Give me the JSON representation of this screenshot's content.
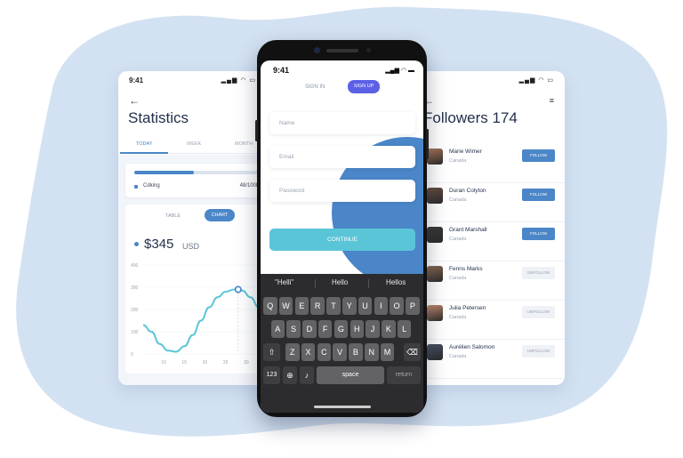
{
  "colors": {
    "accent": "#4a86c8",
    "signup": "#5b60e6",
    "continue": "#5bc5d8",
    "blob": "#d3e2f2"
  },
  "left_screen": {
    "time": "9:41",
    "title": "Statistics",
    "tabs": [
      "TODAY",
      "WEEK",
      "MONTH"
    ],
    "progress_label": "Cdking",
    "progress_value": "48/100km",
    "progress_fraction": 0.48,
    "segments": {
      "table": "TABLE",
      "chart": "CHART"
    },
    "amount": "$345",
    "currency": "USD"
  },
  "chart_data": {
    "type": "line",
    "x_ticks": [
      "10",
      "15",
      "20",
      "25",
      "30"
    ],
    "y_ticks": [
      "0",
      "100",
      "200",
      "300",
      "400"
    ],
    "ylim": [
      0,
      400
    ],
    "xlim": [
      5,
      33
    ],
    "series": [
      {
        "x": [
          5,
          7,
          9,
          11,
          13,
          15,
          17,
          19,
          21,
          23,
          25,
          27,
          29,
          31,
          33
        ],
        "y": [
          130,
          100,
          45,
          15,
          10,
          35,
          85,
          150,
          210,
          255,
          280,
          290,
          285,
          255,
          210
        ]
      }
    ],
    "highlight": {
      "x": 28,
      "y": 290
    }
  },
  "phone": {
    "time": "9:41",
    "signin": "SIGN IN",
    "signup": "SIGN UP",
    "fields": {
      "name": "Name",
      "email": "Email",
      "password": "Password"
    },
    "continue": "CONTINUE",
    "suggestions": [
      "\"Helli\"",
      "Hello",
      "Hellos"
    ],
    "rows": [
      [
        "Q",
        "W",
        "E",
        "R",
        "T",
        "Y",
        "U",
        "I",
        "O",
        "P"
      ],
      [
        "A",
        "S",
        "D",
        "F",
        "G",
        "H",
        "J",
        "K",
        "L"
      ],
      [
        "Z",
        "X",
        "C",
        "V",
        "B",
        "N",
        "M"
      ]
    ],
    "bottom": {
      "numbers": "123",
      "space": "space",
      "return": "return"
    }
  },
  "right_screen": {
    "time": "9:41",
    "title": "Followers 174",
    "followers": [
      {
        "name": "Marie Wimer",
        "country": "Canada",
        "action": "FOLLOW"
      },
      {
        "name": "Duran Colyton",
        "country": "Canada",
        "action": "FOLLOW"
      },
      {
        "name": "Grant Marshall",
        "country": "Canada",
        "action": "FOLLOW"
      },
      {
        "name": "Fenns Marks",
        "country": "Canada",
        "action": "UNFOLLOW"
      },
      {
        "name": "Julia Petersen",
        "country": "Canada",
        "action": "UNFOLLOW"
      },
      {
        "name": "Aurélien Salomon",
        "country": "Canada",
        "action": "UNFOLLOW"
      }
    ]
  }
}
